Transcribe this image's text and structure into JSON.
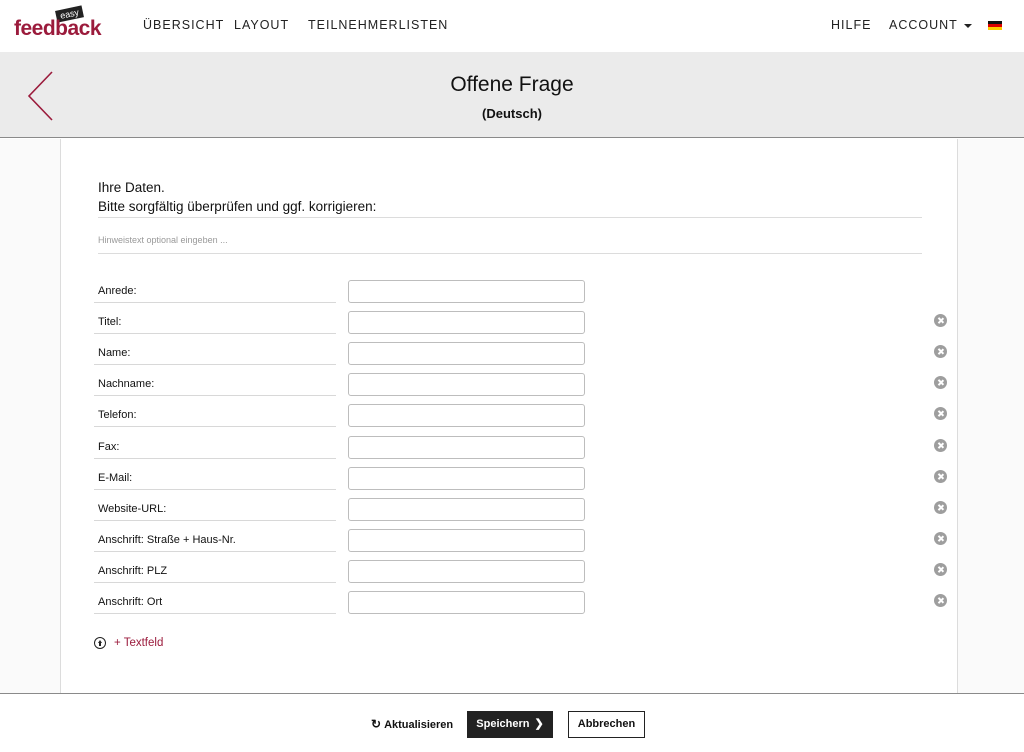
{
  "nav": {
    "logo_top": "easy",
    "logo_word": "feedback",
    "items": [
      "ÜBERSICHT",
      "LAYOUT",
      "TEILNEHMERLISTEN"
    ],
    "help": "HILFE",
    "account": "ACCOUNT",
    "language_flag": "de-flag-icon"
  },
  "header": {
    "title": "Offene Frage",
    "subtitle": "(Deutsch)"
  },
  "question": {
    "line1": "Ihre Daten.",
    "line2": "Bitte sorgfältig überprüfen und ggf. korrigieren:",
    "hint_placeholder": "Hinweistext optional eingeben ..."
  },
  "fields": [
    {
      "label": "Anrede:",
      "value": "",
      "removable": false
    },
    {
      "label": "Titel:",
      "value": "",
      "removable": true
    },
    {
      "label": "Name:",
      "value": "",
      "removable": true
    },
    {
      "label": "Nachname:",
      "value": "",
      "removable": true
    },
    {
      "label": "Telefon:",
      "value": "",
      "removable": true
    },
    {
      "label": "Fax:",
      "value": "",
      "removable": true
    },
    {
      "label": "E-Mail:",
      "value": "",
      "removable": true
    },
    {
      "label": "Website-URL:",
      "value": "",
      "removable": true
    },
    {
      "label": "Anschrift: Straße + Haus-Nr.",
      "value": "",
      "removable": true
    },
    {
      "label": "Anschrift: PLZ",
      "value": "",
      "removable": true
    },
    {
      "label": "Anschrift: Ort",
      "value": "",
      "removable": true
    }
  ],
  "add_field_label": "+ Textfeld",
  "footer": {
    "refresh": "Aktualisieren",
    "save": "Speichern",
    "cancel": "Abbrechen"
  },
  "colors": {
    "accent": "#9b1b3c",
    "header_bg": "#ebebeb",
    "button_dark": "#222222"
  }
}
